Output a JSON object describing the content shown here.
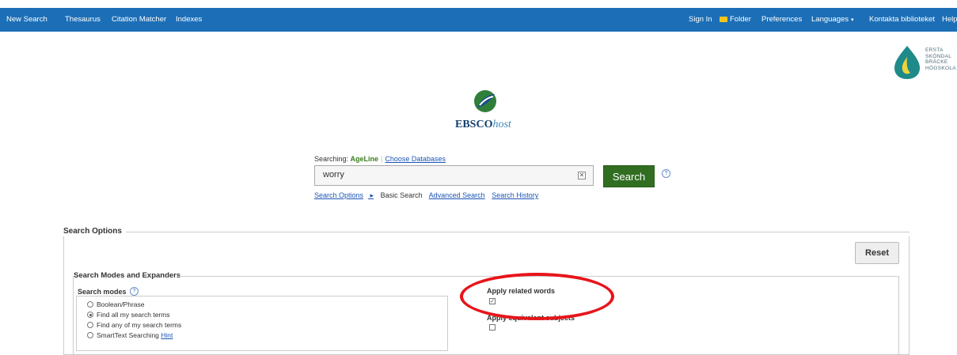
{
  "topnav": {
    "new_search": "New Search",
    "thesaurus": "Thesaurus",
    "citation_matcher": "Citation Matcher",
    "indexes": "Indexes",
    "sign_in": "Sign In",
    "folder": "Folder",
    "preferences": "Preferences",
    "languages": "Languages",
    "library_contact": "Kontakta biblioteket",
    "help": "Help"
  },
  "institution_logo": {
    "lines": [
      "ERSTA",
      "SKÖNDAL",
      "BRÄCKE",
      "HÖGSKOLA"
    ]
  },
  "brand": {
    "name_bold": "EBSCO",
    "name_italic": "host"
  },
  "search": {
    "searching_label": "Searching:",
    "database": "AgeLine",
    "choose_databases": "Choose Databases",
    "query": "worry",
    "button_label": "Search",
    "links": {
      "search_options": "Search Options",
      "basic_search": "Basic Search",
      "advanced_search": "Advanced Search",
      "search_history": "Search History"
    }
  },
  "search_options": {
    "title": "Search Options",
    "reset_label": "Reset",
    "modes_section_title": "Search Modes and Expanders",
    "search_modes": {
      "title": "Search modes",
      "options": [
        {
          "label": "Boolean/Phrase",
          "selected": false
        },
        {
          "label": "Find all my search terms",
          "selected": true
        },
        {
          "label": "Find any of my search terms",
          "selected": false
        },
        {
          "label": "SmartText Searching",
          "selected": false,
          "hint": "Hint"
        }
      ]
    },
    "expanders": {
      "related_words": {
        "label": "Apply related words",
        "checked": true
      },
      "equivalent_subjects": {
        "label": "Apply equivalent subjects",
        "checked": false
      }
    }
  },
  "colors": {
    "nav_bar": "#1c6fb7",
    "search_button": "#316e22",
    "database_name": "#3a7d1e",
    "link": "#1c55b7",
    "annotation_circle": "#e8141a"
  }
}
